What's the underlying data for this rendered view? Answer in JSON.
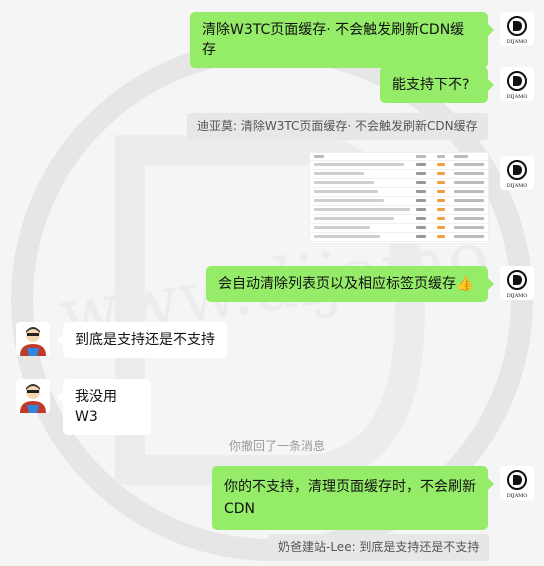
{
  "messages": {
    "m1": "清除W3TC页面缓存· 不会触发刷新CDN缓存",
    "m2": "能支持下不?",
    "m2_quote": "迪亚莫: 清除W3TC页面缓存· 不会触发刷新CDN缓存",
    "m4": "会自动清除列表页以及相应标签页缓存👍",
    "m5": "到底是支持还是不支持",
    "m6": "我没用W3",
    "recall_notice": "你撤回了一条消息",
    "m7": "你的不支持，清理页面缓存时，不会刷新CDN",
    "m7_quote": "奶爸建站-Lee: 到底是支持还是不支持"
  },
  "avatars": {
    "self_logo_text": "DIJAMO",
    "other": "cartoon-user-icon"
  },
  "colors": {
    "background": "#f5f5f5",
    "sent_bubble": "#95ec69",
    "received_bubble": "#ffffff",
    "quote_bg": "#e7e7e7",
    "system_text": "#9a9a9a"
  }
}
